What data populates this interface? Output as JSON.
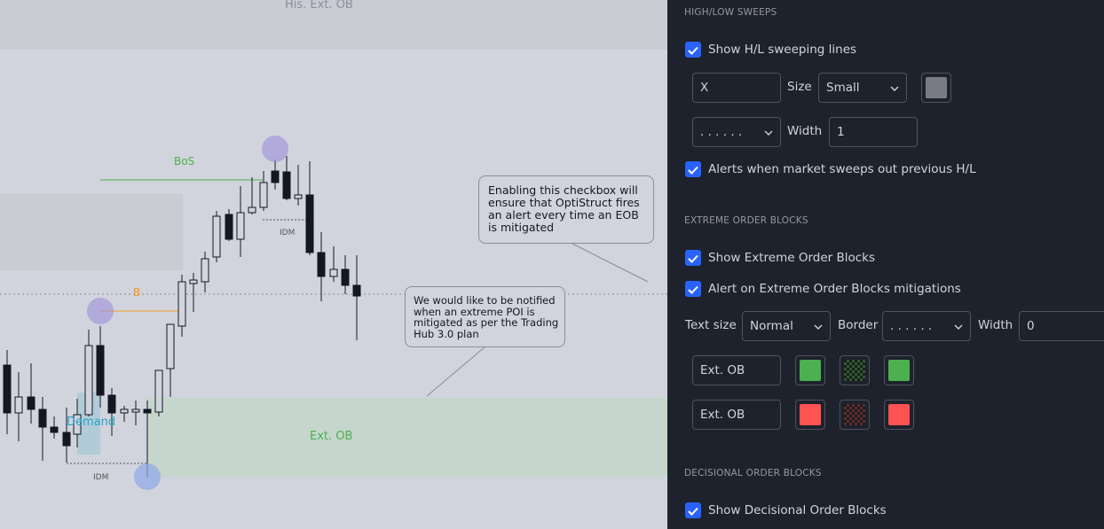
{
  "chart": {
    "labels": {
      "top_zone": "His. Ext. OB",
      "bos": "BoS",
      "b": "B",
      "idm_top": "IDM",
      "idm_bottom": "IDM",
      "demand": "Demand",
      "bottom_zone": "Ext. OB"
    },
    "callouts": {
      "checkbox_note": "Enabling this checkbox will ensure that OptiStruct fires an alert every time an EOB is mitigated",
      "notify_note": "We would like to be notified when an extreme POI is mitigated as per the Trading Hub 3.0 plan"
    },
    "colors": {
      "background": "#d1d4dc",
      "bos_line": "#4caf50",
      "b_line": "#f59a23",
      "demand": "#26a69a",
      "sweep_circle": "#9c8ed8",
      "ext_ob_zone": "#c6d6cc"
    }
  },
  "panel": {
    "sweeps": {
      "title": "HIGH/LOW SWEEPS",
      "show_lines": "Show H/L sweeping lines",
      "symbol_value": "X",
      "size_label": "Size",
      "size_value": "Small",
      "line_style": ". . . . . .",
      "width_label": "Width",
      "width_value": "1",
      "alerts": "Alerts when market sweeps out previous H/L",
      "swatch_color": "#787b86"
    },
    "extreme": {
      "title": "EXTREME ORDER BLOCKS",
      "show": "Show Extreme Order Blocks",
      "alert": "Alert on Extreme Order Blocks mitigations",
      "text_size_label": "Text size",
      "text_size_value": "Normal",
      "border_label": "Border",
      "border_value": ". . . . . .",
      "width_label": "Width",
      "width_value": "0",
      "bull_text": "Ext. OB",
      "bear_text": "Ext. OB",
      "bull_color": "#4caf50",
      "bear_color": "#ff5252"
    },
    "decisional": {
      "title": "DECISIONAL ORDER BLOCKS",
      "show": "Show Decisional Order Blocks"
    }
  }
}
